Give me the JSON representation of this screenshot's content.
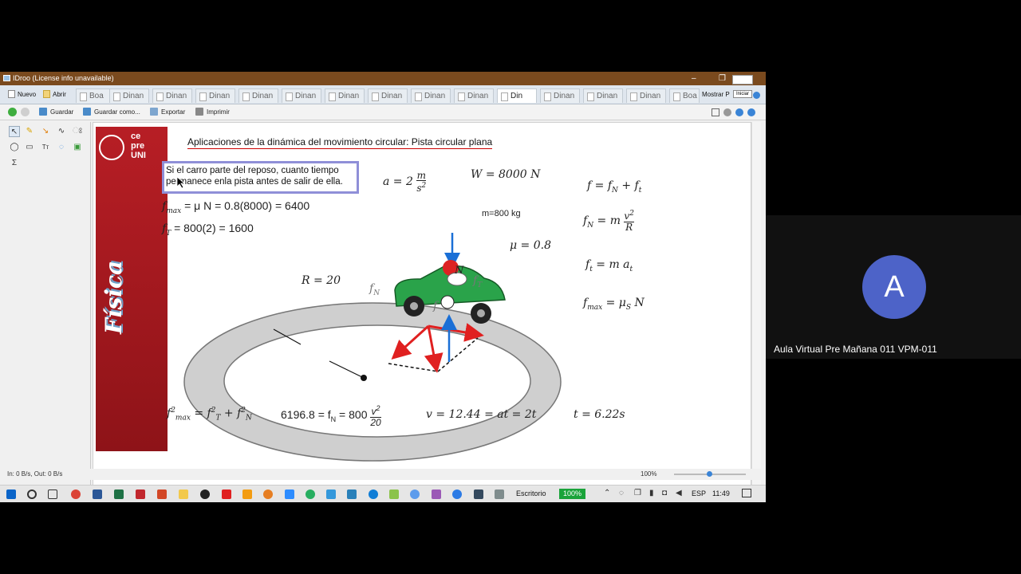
{
  "window": {
    "title": "IDroo (License info unavailable)",
    "tabs": {
      "new_label": "Nuevo",
      "open_label": "Abrir",
      "doc_tabs": [
        "Boa",
        "Dinan",
        "Dinan",
        "Dinan",
        "Dinan",
        "Dinan",
        "Dinan",
        "Dinan",
        "Dinan",
        "Dinan",
        "Din",
        "Dinan",
        "Dinan",
        "Dinan",
        "Boa"
      ],
      "show_label": "Mostrar P",
      "tooltip": "Iniciar"
    },
    "toolbar": {
      "save_label": "Guardar",
      "save_as_label": "Guardar como...",
      "export_label": "Exportar",
      "print_label": "Imprimir"
    },
    "status": {
      "io": "In: 0 B/s, Out: 0 B/s",
      "zoom": "100%"
    }
  },
  "slide": {
    "logo": "ce\npre\nUNI",
    "banner_text": "Física",
    "title": "Aplicaciones de la dinámica del movimiento circular:   Pista circular plana",
    "question": "Si el carro parte del reposo, cuanto tiempo permanece enla pista antes de salir de ella.",
    "fmax_line": "= μ N = 0.8(8000) = 6400",
    "ft_line": "= 800(2) = 1600",
    "accel": "a = 2",
    "weight": "W = 8000 N",
    "mass": "m=800 kg",
    "mu": "μ = 0.8",
    "radius": "R = 20",
    "normal_label": "N",
    "rhs": {
      "f_total": "f = f",
      "fn_def": "f",
      "ft_def": "f",
      "fmax_def": "f"
    },
    "bottom": {
      "eq1": "f",
      "eq2": "6196.8 = f",
      "eq3": "v = 12.44 = at = 2t",
      "eq4": "t = 6.22s"
    }
  },
  "taskbar": {
    "desktop_label": "Escritorio",
    "battery": "100%",
    "lang": "ESP",
    "time": "11:49"
  },
  "meeting": {
    "avatar_letter": "A",
    "participant_name": "Aula Virtual Pre Mañana 011 VPM-011"
  },
  "colors": {
    "banner_red": "#b71e25",
    "titlebar": "#7a4a1e",
    "avatar": "#4d63c8",
    "car_green": "#2aa34a",
    "arrow_red": "#e02020",
    "arrow_blue": "#1a6fd6"
  }
}
